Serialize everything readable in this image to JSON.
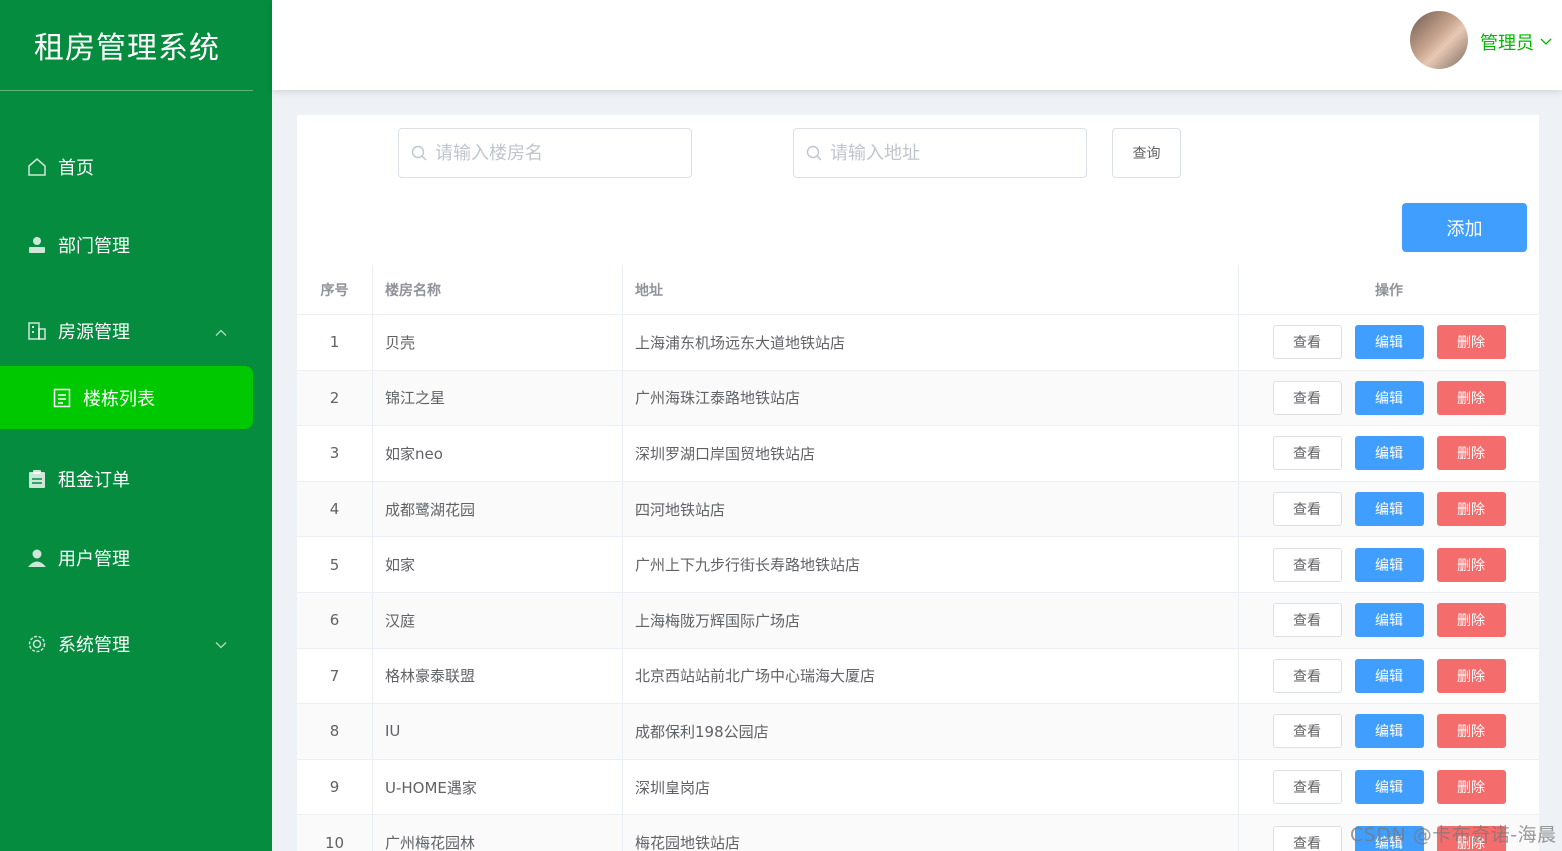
{
  "app": {
    "title": "租房管理系统"
  },
  "sidebar": {
    "items": [
      {
        "label": "首页",
        "icon": "home-icon"
      },
      {
        "label": "部门管理",
        "icon": "person-icon"
      },
      {
        "label": "房源管理",
        "icon": "building-icon",
        "expanded": true
      },
      {
        "label": "租金订单",
        "icon": "clipboard-icon"
      },
      {
        "label": "用户管理",
        "icon": "user-icon"
      },
      {
        "label": "系统管理",
        "icon": "gear-icon",
        "expanded": false
      }
    ],
    "sub_items": [
      {
        "label": "楼栋列表",
        "icon": "document-icon",
        "active": true
      }
    ]
  },
  "header": {
    "user_name": "管理员"
  },
  "search": {
    "building_placeholder": "请输入楼房名",
    "address_placeholder": "请输入地址",
    "query_label": "查询",
    "add_label": "添加"
  },
  "table": {
    "columns": [
      "序号",
      "楼房名称",
      "地址",
      "操作"
    ],
    "actions": {
      "view": "查看",
      "edit": "编辑",
      "delete": "删除"
    },
    "rows": [
      {
        "no": "1",
        "name": "贝壳",
        "address": "上海浦东机场远东大道地铁站店"
      },
      {
        "no": "2",
        "name": "锦江之星",
        "address": "广州海珠江泰路地铁站店"
      },
      {
        "no": "3",
        "name": "如家neo",
        "address": "深圳罗湖口岸国贸地铁站店"
      },
      {
        "no": "4",
        "name": "成都鹭湖花园",
        "address": "四河地铁站店"
      },
      {
        "no": "5",
        "name": "如家",
        "address": "广州上下九步行街长寿路地铁站店"
      },
      {
        "no": "6",
        "name": "汉庭",
        "address": "上海梅陇万辉国际广场店"
      },
      {
        "no": "7",
        "name": "格林豪泰联盟",
        "address": "北京西站站前北广场中心瑞海大厦店"
      },
      {
        "no": "8",
        "name": "IU",
        "address": "成都保利198公园店"
      },
      {
        "no": "9",
        "name": "U-HOME遇家",
        "address": "深圳皇岗店"
      },
      {
        "no": "10",
        "name": "广州梅花园林",
        "address": "梅花园地铁站店"
      }
    ]
  },
  "watermark": "CSDN @卡布奇诺-海晨",
  "colors": {
    "sidebar_bg": "#058c3e",
    "active_item_bg": "#00c800",
    "primary": "#409eff",
    "danger": "#f56c6c",
    "username": "#00b800"
  }
}
